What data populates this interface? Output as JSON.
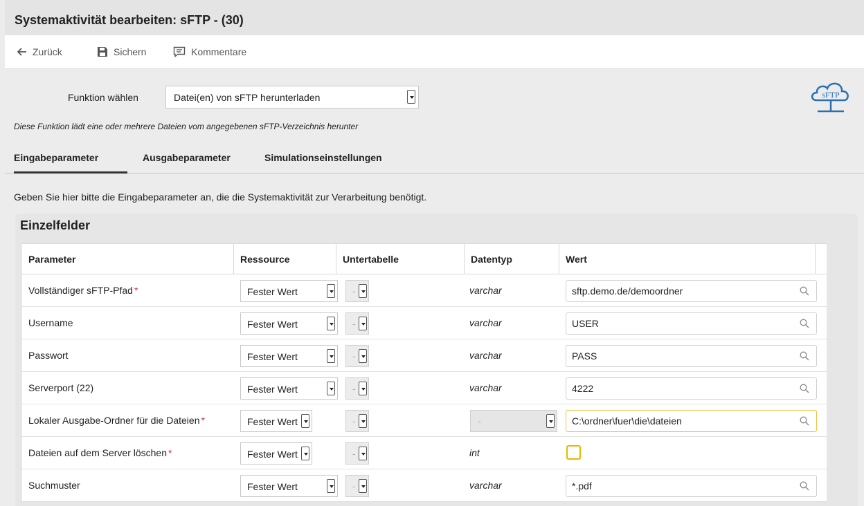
{
  "title": "Systemaktivität bearbeiten: sFTP - (30)",
  "toolbar": {
    "back_label": "Zurück",
    "save_label": "Sichern",
    "comments_label": "Kommentare"
  },
  "function": {
    "label": "Funktion wählen",
    "selected": "Datei(en) von sFTP herunterladen",
    "description": "Diese Funktion lädt eine oder mehrere Dateien vom angegebenen sFTP-Verzeichnis herunter"
  },
  "logo_text": "sFTP",
  "tabs": [
    {
      "label": "Eingabeparameter",
      "active": true
    },
    {
      "label": "Ausgabeparameter",
      "active": false
    },
    {
      "label": "Simulationseinstellungen",
      "active": false
    }
  ],
  "intro": "Geben Sie hier bitte die Eingabeparameter an, die die Systemaktivität zur Verarbeitung benötigt.",
  "panel_title": "Einzelfelder",
  "table": {
    "headers": [
      "Parameter",
      "Ressource",
      "Untertabelle",
      "Datentyp",
      "Wert"
    ],
    "rows": [
      {
        "param": "Vollständiger sFTP-Pfad",
        "required": "*",
        "resource": "Fester Wert",
        "sub": "-",
        "dtype": "varchar",
        "value": "sftp.demo.de/demoordner"
      },
      {
        "param": "Username",
        "required": "",
        "resource": "Fester Wert",
        "sub": "-",
        "dtype": "varchar",
        "value": "USER"
      },
      {
        "param": "Passwort",
        "required": "",
        "resource": "Fester Wert",
        "sub": "-",
        "dtype": "varchar",
        "value": "PASS"
      },
      {
        "param": "Serverport (22)",
        "required": "",
        "resource": "Fester Wert",
        "sub": "-",
        "dtype": "varchar",
        "value": "4222"
      },
      {
        "param": "Lokaler Ausgabe-Ordner für die Dateien",
        "required": "*",
        "resource": "Fester Wert",
        "sub": "-",
        "dtype": "-",
        "value": "C:\\ordner\\fuer\\die\\dateien"
      },
      {
        "param": "Dateien auf dem Server löschen",
        "required": "*",
        "resource": "Fester Wert",
        "sub": "-",
        "dtype": "int",
        "value": ""
      },
      {
        "param": "Suchmuster",
        "required": "",
        "resource": "Fester Wert",
        "sub": "-",
        "dtype": "varchar",
        "value": "*.pdf"
      }
    ]
  },
  "colors": {
    "required": "#d9363e",
    "focus_border": "#f0c040",
    "checkbox_border": "#f0b400",
    "logo": "#2a6fb0"
  }
}
